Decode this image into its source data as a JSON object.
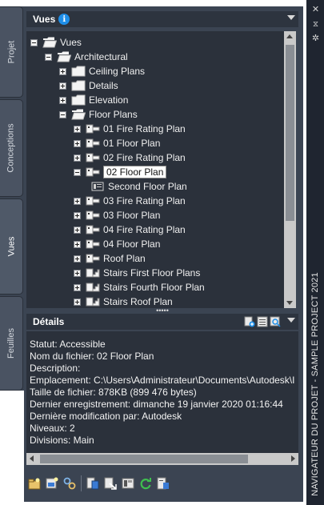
{
  "left_tabs": [
    "Projet",
    "Conceptions",
    "Vues",
    "Feuilles"
  ],
  "active_tab": "Vues",
  "palette_title": "NAVIGATEUR DU PROJET - SAMPLE PROJECT 2021",
  "vues_panel": {
    "title": "Vues",
    "info_icon": "i",
    "tree": [
      {
        "label": "Vues",
        "level": 0,
        "toggle": "minus",
        "icon": "folder-open-icon"
      },
      {
        "label": "Architectural",
        "level": 1,
        "toggle": "minus",
        "icon": "folder-open-icon"
      },
      {
        "label": "Ceiling Plans",
        "level": 2,
        "toggle": "plus",
        "icon": "folder-icon"
      },
      {
        "label": "Details",
        "level": 2,
        "toggle": "plus",
        "icon": "folder-icon"
      },
      {
        "label": "Elevation",
        "level": 2,
        "toggle": "plus",
        "icon": "folder-icon"
      },
      {
        "label": "Floor Plans",
        "level": 2,
        "toggle": "minus",
        "icon": "folder-open-icon"
      },
      {
        "label": "01 Fire Rating Plan",
        "level": 3,
        "toggle": "plus",
        "icon": "view-icon"
      },
      {
        "label": "01 Floor Plan",
        "level": 3,
        "toggle": "plus",
        "icon": "view-icon"
      },
      {
        "label": "02 Fire Rating Plan",
        "level": 3,
        "toggle": "plus",
        "icon": "view-icon"
      },
      {
        "label": "02 Floor Plan",
        "level": 3,
        "toggle": "minus",
        "icon": "view-icon",
        "selected": true
      },
      {
        "label": "Second Floor Plan",
        "level": 4,
        "toggle": "none",
        "icon": "sheet-view-icon"
      },
      {
        "label": "03 Fire Rating Plan",
        "level": 3,
        "toggle": "plus",
        "icon": "view-icon"
      },
      {
        "label": "03 Floor Plan",
        "level": 3,
        "toggle": "plus",
        "icon": "view-icon"
      },
      {
        "label": "04 Fire Rating Plan",
        "level": 3,
        "toggle": "plus",
        "icon": "view-icon"
      },
      {
        "label": "04 Floor Plan",
        "level": 3,
        "toggle": "plus",
        "icon": "view-icon"
      },
      {
        "label": "Roof Plan",
        "level": 3,
        "toggle": "plus",
        "icon": "view-icon"
      },
      {
        "label": "Stairs First Floor Plans",
        "level": 3,
        "toggle": "plus",
        "icon": "stair-view-icon"
      },
      {
        "label": "Stairs Fourth Floor Plan",
        "level": 3,
        "toggle": "plus",
        "icon": "stair-view-icon"
      },
      {
        "label": "Stairs Roof Plan",
        "level": 3,
        "toggle": "plus",
        "icon": "stair-view-icon"
      }
    ]
  },
  "details_panel": {
    "title": "Détails",
    "lines": [
      "Statut: Accessible",
      "Nom du fichier: 02 Floor Plan",
      "Description:",
      "Emplacement: C:\\Users\\Administrateur\\Documents\\Autodesk\\I",
      "Taille de fichier: 878KB (899 476 bytes)",
      "Dernier enregistrement: dimanche 19 janvier 2020  01:16:44",
      "Dernière modification par: Autodesk",
      "Niveaux: 2",
      "Divisions: Main"
    ]
  },
  "toolbar": [
    "new-view-icon",
    "new-view-dwg-icon",
    "project-setup-icon",
    "open-xref-icon",
    "repath-icon",
    "sheet-icon",
    "refresh-icon",
    "launch-icon"
  ],
  "colors": {
    "panel_bg": "#3b4452",
    "tree_bg": "#2b313b",
    "header_bg": "#2d343f",
    "accent": "#1e8ee8"
  }
}
